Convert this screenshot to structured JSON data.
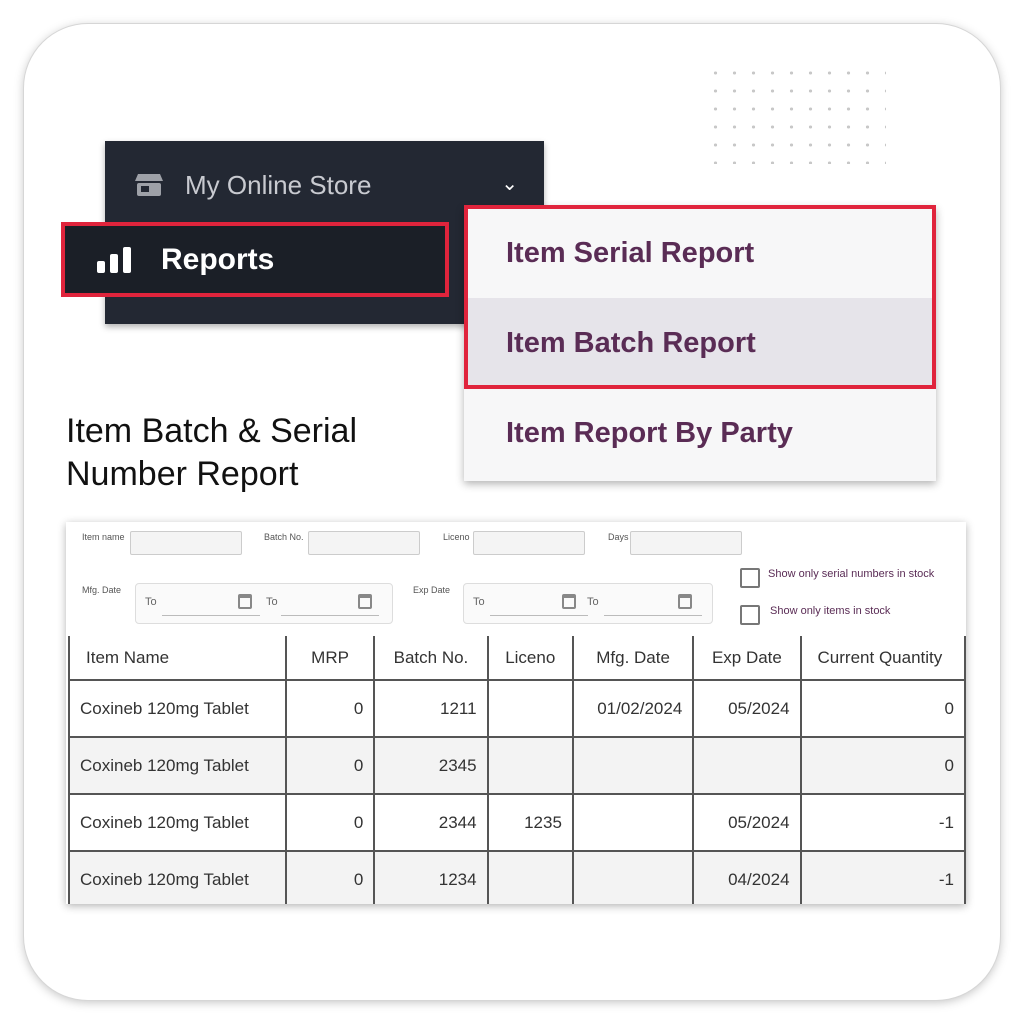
{
  "sidebar": {
    "store_label": "My Online Store",
    "store_icon": "store-icon",
    "chevron_icon": "chevron-down-icon",
    "reports_label": "Reports",
    "reports_icon": "bar-chart-icon"
  },
  "menu": {
    "items": [
      "Item Serial Report",
      "Item Batch Report",
      "Item Report By Party"
    ],
    "selected": "Item Batch Report"
  },
  "heading": {
    "line1": "Item Batch & Serial",
    "line2": "Number Report"
  },
  "filters": {
    "item_name": "Item name",
    "batch_no": "Batch No.",
    "liceno": "Liceno",
    "days": "Days",
    "mfg_date": "Mfg. Date",
    "exp_date": "Exp Date",
    "to": "To",
    "show_serial": "Show only serial numbers in stock",
    "show_items": "Show only items in stock"
  },
  "table": {
    "columns": [
      "Item Name",
      "MRP",
      "Batch No.",
      "Liceno",
      "Mfg. Date",
      "Exp Date",
      "Current Quantity"
    ],
    "rows": [
      [
        "Coxineb 120mg Tablet",
        "0",
        "1211",
        "",
        "01/02/2024",
        "05/2024",
        "0"
      ],
      [
        "Coxineb 120mg Tablet",
        "0",
        "2345",
        "",
        "",
        "",
        "0"
      ],
      [
        "Coxineb 120mg Tablet",
        "0",
        "2344",
        "1235",
        "",
        "05/2024",
        "-1"
      ],
      [
        "Coxineb 120mg Tablet",
        "0",
        "1234",
        "",
        "",
        "04/2024",
        "-1"
      ]
    ]
  },
  "colors": {
    "highlight": "#e0243c",
    "menu_text": "#5a2c55",
    "sidebar_bg": "#232833"
  }
}
